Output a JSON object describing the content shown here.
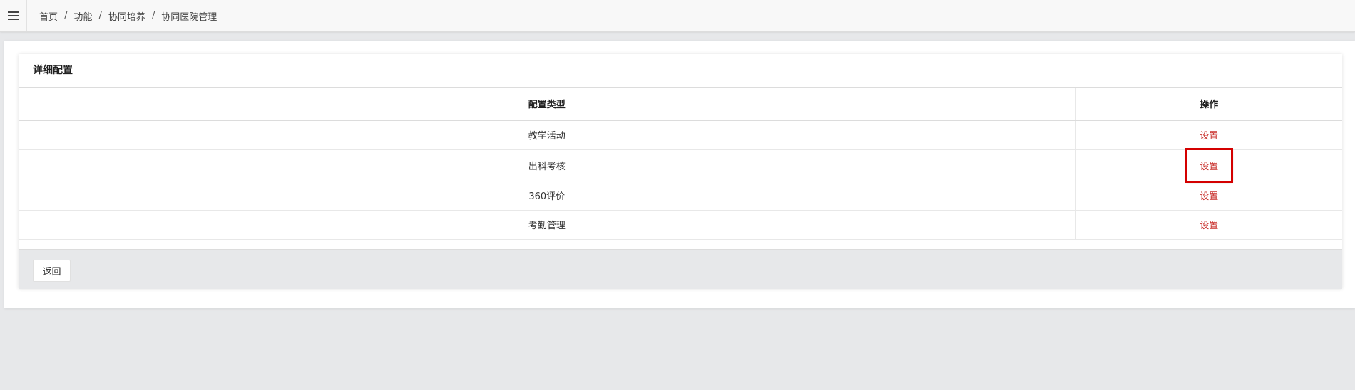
{
  "breadcrumb": {
    "items": [
      "首页",
      "功能",
      "协同培养",
      "协同医院管理"
    ],
    "separator": "/"
  },
  "panel": {
    "title": "详细配置",
    "columns": [
      "配置类型",
      "操作"
    ],
    "rows": [
      {
        "type": "教学活动",
        "action": "设置"
      },
      {
        "type": "出科考核",
        "action": "设置"
      },
      {
        "type": "360评价",
        "action": "设置"
      },
      {
        "type": "考勤管理",
        "action": "设置"
      }
    ],
    "back_label": "返回"
  },
  "colors": {
    "link": "#c9302c",
    "highlight": "#d40000",
    "background": "#e7e8ea"
  },
  "icons": {
    "menu": "hamburger-icon"
  }
}
